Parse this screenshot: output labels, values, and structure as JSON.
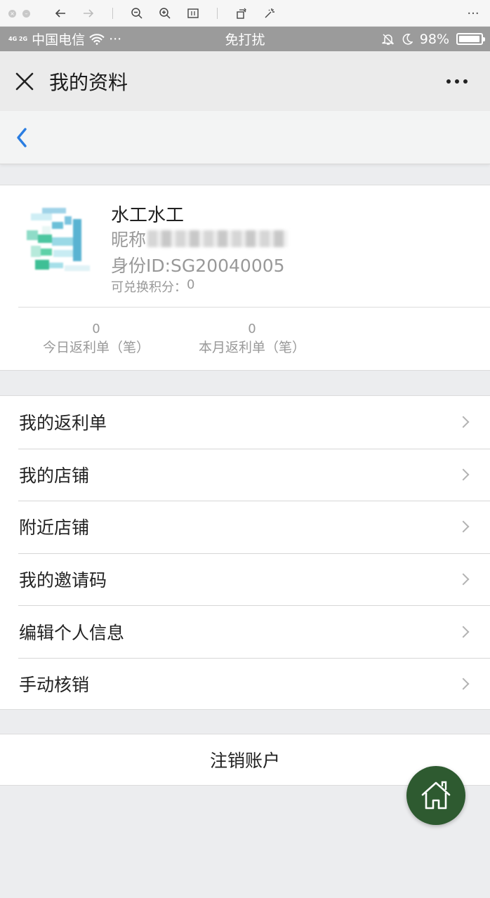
{
  "status_bar": {
    "network": "4G 2G",
    "carrier": "中国电信",
    "extra": "···",
    "center_text": "免打扰",
    "battery": "98%"
  },
  "title_bar": {
    "title": "我的资料"
  },
  "profile": {
    "name": "水工水工",
    "nickname_label": "昵称",
    "id_text": "身份ID:SG20040005",
    "points_label": "可兑换积分：",
    "points_value": "0",
    "stats": [
      {
        "value": "0",
        "label": "今日返利单（笔）"
      },
      {
        "value": "0",
        "label": "本月返利单（笔）"
      }
    ]
  },
  "menu": {
    "items": [
      {
        "label": "我的返利单"
      },
      {
        "label": "我的店铺"
      },
      {
        "label": "附近店铺"
      },
      {
        "label": "我的邀请码"
      },
      {
        "label": "编辑个人信息"
      },
      {
        "label": "手动核销"
      }
    ]
  },
  "logout": {
    "label": "注销账户"
  },
  "colors": {
    "accent_blue": "#2a7de1",
    "fab_green": "#2e5a30",
    "status_bar_gray": "#9b9b9b"
  },
  "icons": {
    "close": "close-icon",
    "back": "back-chevron-icon",
    "more": "more-dots-icon",
    "home": "home-icon",
    "menu_chevron": "chevron-right-icon"
  }
}
